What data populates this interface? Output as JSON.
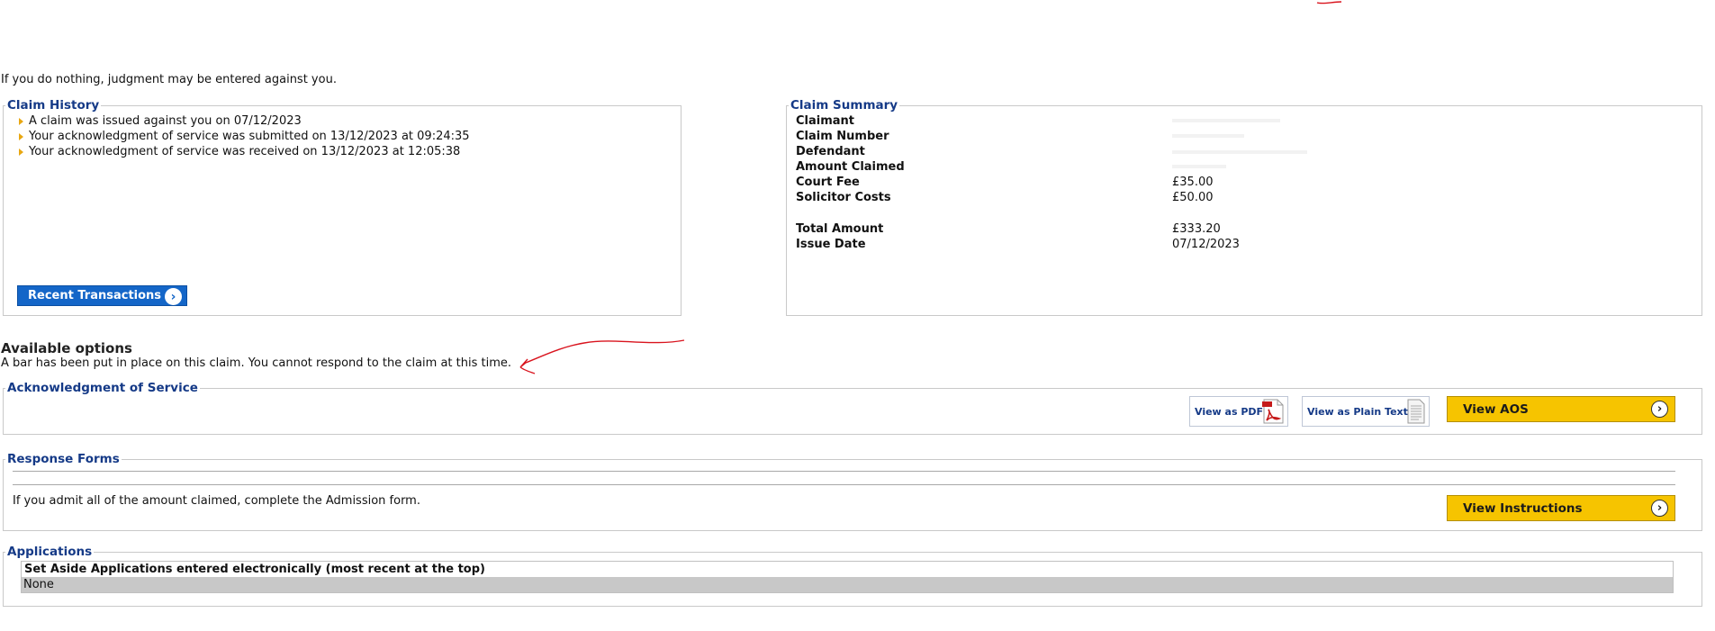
{
  "warning": "If you do nothing, judgment may be entered against you.",
  "claim_history": {
    "title": "Claim History",
    "items": [
      "A claim was issued against you on 07/12/2023",
      "Your acknowledgment of service was submitted on 13/12/2023 at 09:24:35",
      "Your acknowledgment of service was received on 13/12/2023 at 12:05:38"
    ],
    "button_label": "Recent Transactions"
  },
  "claim_summary": {
    "title": "Claim Summary",
    "rows": [
      {
        "label": "Claimant",
        "value": ""
      },
      {
        "label": "Claim Number",
        "value": ""
      },
      {
        "label": "Defendant",
        "value": ""
      },
      {
        "label": "Amount Claimed",
        "value": ""
      },
      {
        "label": "Court Fee",
        "value": "£35.00"
      },
      {
        "label": "Solicitor Costs",
        "value": "£50.00"
      },
      {
        "label": "Total Amount",
        "value": "£333.20"
      },
      {
        "label": "Issue Date",
        "value": "07/12/2023"
      }
    ]
  },
  "options": {
    "title": "Available options",
    "bar_message": "A bar has been put in place on this claim. You cannot respond to the claim at this time."
  },
  "aos": {
    "title": "Acknowledgment of Service",
    "view_pdf": "View as PDF",
    "view_text": "View as Plain Text",
    "view_aos": "View AOS"
  },
  "response_forms": {
    "title": "Response Forms",
    "text": "If you admit all of the amount claimed, complete the Admission form.",
    "button": "View Instructions"
  },
  "applications": {
    "title": "Applications",
    "table_header": "Set Aside Applications entered electronically (most recent at the top)",
    "table_value": "None"
  },
  "icons": {
    "bullet": "triangle-bullet-icon",
    "arrow": "chevron-right-circle-icon",
    "pdf": "pdf-document-icon",
    "text": "text-document-icon"
  },
  "colors": {
    "legend": "#153a87",
    "primary_button": "#1466c8",
    "action_button": "#f6c400",
    "bullet": "#e8a712",
    "annotation": "#d9141e"
  }
}
